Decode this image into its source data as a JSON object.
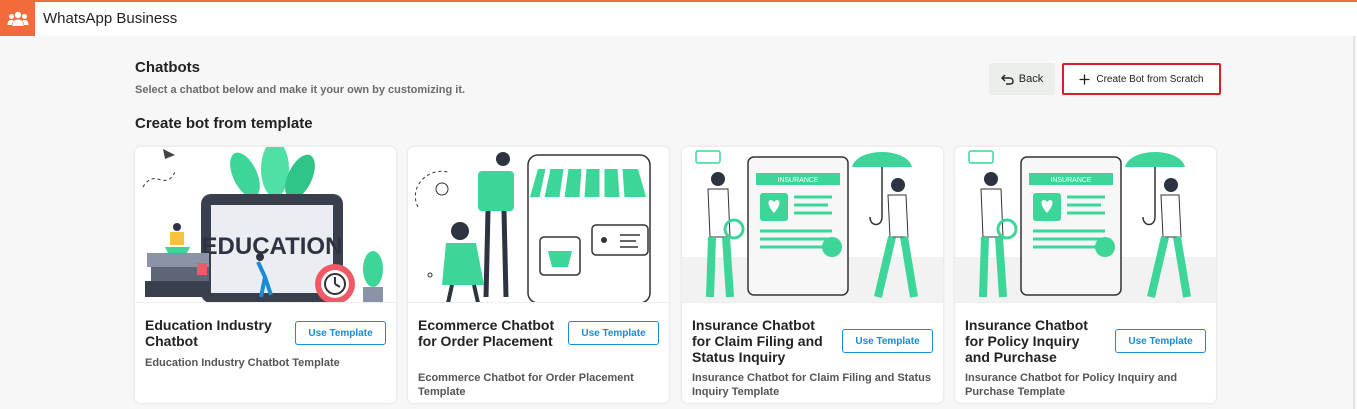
{
  "app": {
    "title": "WhatsApp Business",
    "logo_icon": "users-group-icon"
  },
  "page": {
    "title": "Chatbots",
    "subtitle": "Select a chatbot below and make it your own by customizing it.",
    "section_title": "Create bot from template"
  },
  "actions": {
    "back_label": "Back",
    "create_label": "Create Bot from Scratch"
  },
  "colors": {
    "brand": "#f26b3a",
    "accent": "#1a8bd6",
    "illustration_green": "#3dd598",
    "highlight_border": "#d81f26"
  },
  "templates": [
    {
      "title": "Education Industry Chatbot",
      "button": "Use Template",
      "description": "Education Industry Chatbot Template",
      "image_text": "EDUCATION"
    },
    {
      "title": "Ecommerce Chatbot for Order Placement",
      "button": "Use Template",
      "description": "Ecommerce Chatbot for Order Placement Template"
    },
    {
      "title": "Insurance Chatbot for Claim Filing and Status Inquiry",
      "button": "Use Template",
      "description": "Insurance Chatbot for Claim Filing and Status Inquiry Template",
      "image_text": "INSURANCE"
    },
    {
      "title": "Insurance Chatbot for Policy Inquiry and Purchase",
      "button": "Use Template",
      "description": "Insurance Chatbot for Policy Inquiry and Purchase Template",
      "image_text": "INSURANCE"
    }
  ]
}
